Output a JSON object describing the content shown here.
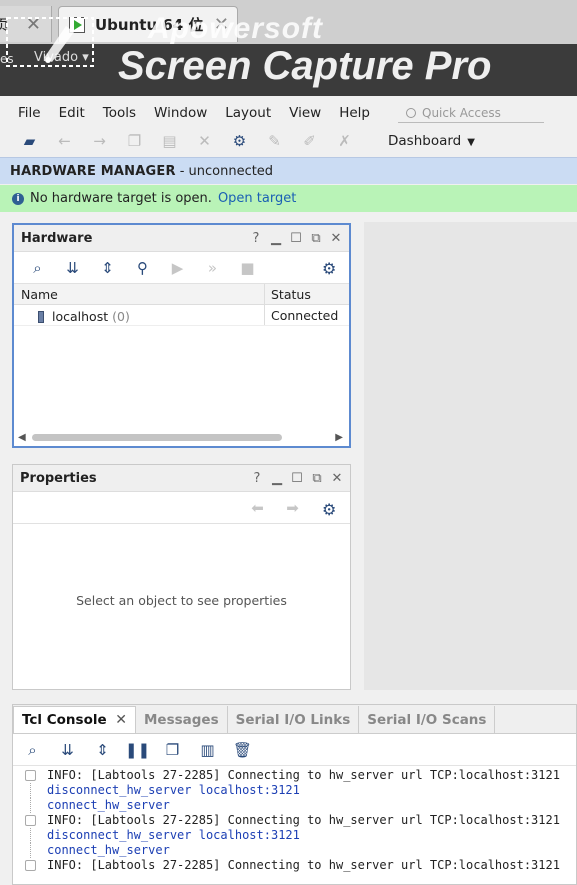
{
  "host": {
    "left_tab_label": "页",
    "main_tab_label": "Ubuntu 64 位"
  },
  "watermark": {
    "line1": "Apowersoft",
    "line2": "Screen Capture Pro"
  },
  "appbar": {
    "left_text": "es",
    "vivado_label": "Vivado"
  },
  "menubar": {
    "items": [
      "File",
      "Edit",
      "Tools",
      "Window",
      "Layout",
      "View",
      "Help"
    ],
    "quick_access_placeholder": "Quick Access"
  },
  "toolbar": {
    "dashboard_label": "Dashboard"
  },
  "manager": {
    "title": "HARDWARE MANAGER",
    "status": "- unconnected"
  },
  "notice": {
    "text": "No hardware target is open.",
    "link": "Open target"
  },
  "hardware_panel": {
    "title": "Hardware",
    "columns": [
      "Name",
      "Status"
    ],
    "rows": [
      {
        "name": "localhost",
        "count": "(0)",
        "status": "Connected"
      }
    ]
  },
  "properties_panel": {
    "title": "Properties",
    "empty_text": "Select an object to see properties"
  },
  "console": {
    "tabs": [
      "Tcl Console",
      "Messages",
      "Serial I/O Links",
      "Serial I/O Scans"
    ],
    "lines": [
      {
        "kind": "info",
        "text": "INFO: [Labtools 27-2285] Connecting to hw_server url TCP:localhost:3121"
      },
      {
        "kind": "cmd",
        "text": "disconnect_hw_server localhost:3121"
      },
      {
        "kind": "cmd",
        "text": "connect_hw_server"
      },
      {
        "kind": "info",
        "text": "INFO: [Labtools 27-2285] Connecting to hw_server url TCP:localhost:3121"
      },
      {
        "kind": "cmd",
        "text": "disconnect_hw_server localhost:3121"
      },
      {
        "kind": "cmd",
        "text": "connect_hw_server"
      },
      {
        "kind": "info",
        "text": "INFO: [Labtools 27-2285] Connecting to hw_server url TCP:localhost:3121"
      }
    ]
  },
  "colors": {
    "manager_banner": "#cbdcf3",
    "notice_banner": "#b9f3b7",
    "link": "#1a5fb4",
    "command_text": "#1c3fb4",
    "panel_focus_border": "#5d8ad0"
  }
}
